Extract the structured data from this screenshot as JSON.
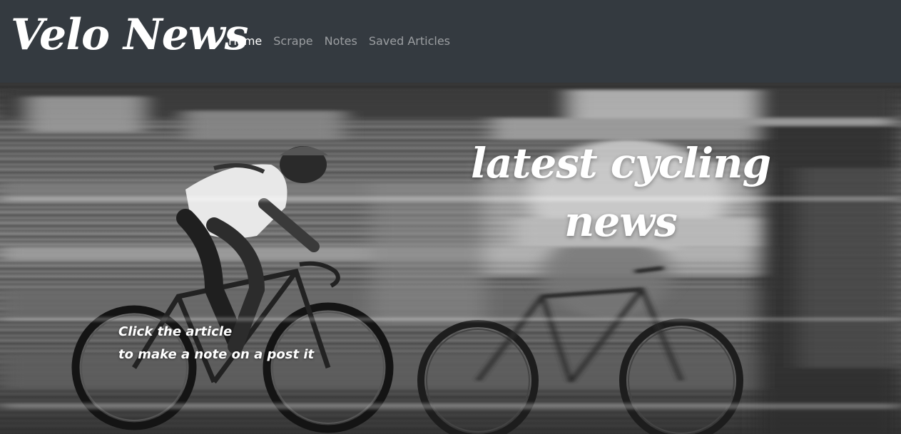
{
  "brand": {
    "title": "Velo News"
  },
  "nav": {
    "items": [
      {
        "label": "Home",
        "active": true
      },
      {
        "label": "Scrape",
        "active": false
      },
      {
        "label": "Notes",
        "active": false
      },
      {
        "label": "Saved Articles",
        "active": false
      }
    ]
  },
  "hero": {
    "title_line1": "latest cycling",
    "title_line2": "news",
    "hint_line1": "Click the article",
    "hint_line2": "to make a note on a post it"
  },
  "colors": {
    "navbar_bg": "#343a40",
    "nav_active": "#ffffff",
    "nav_inactive": "rgba(255,255,255,0.5)",
    "hero_text": "#ffffff"
  }
}
